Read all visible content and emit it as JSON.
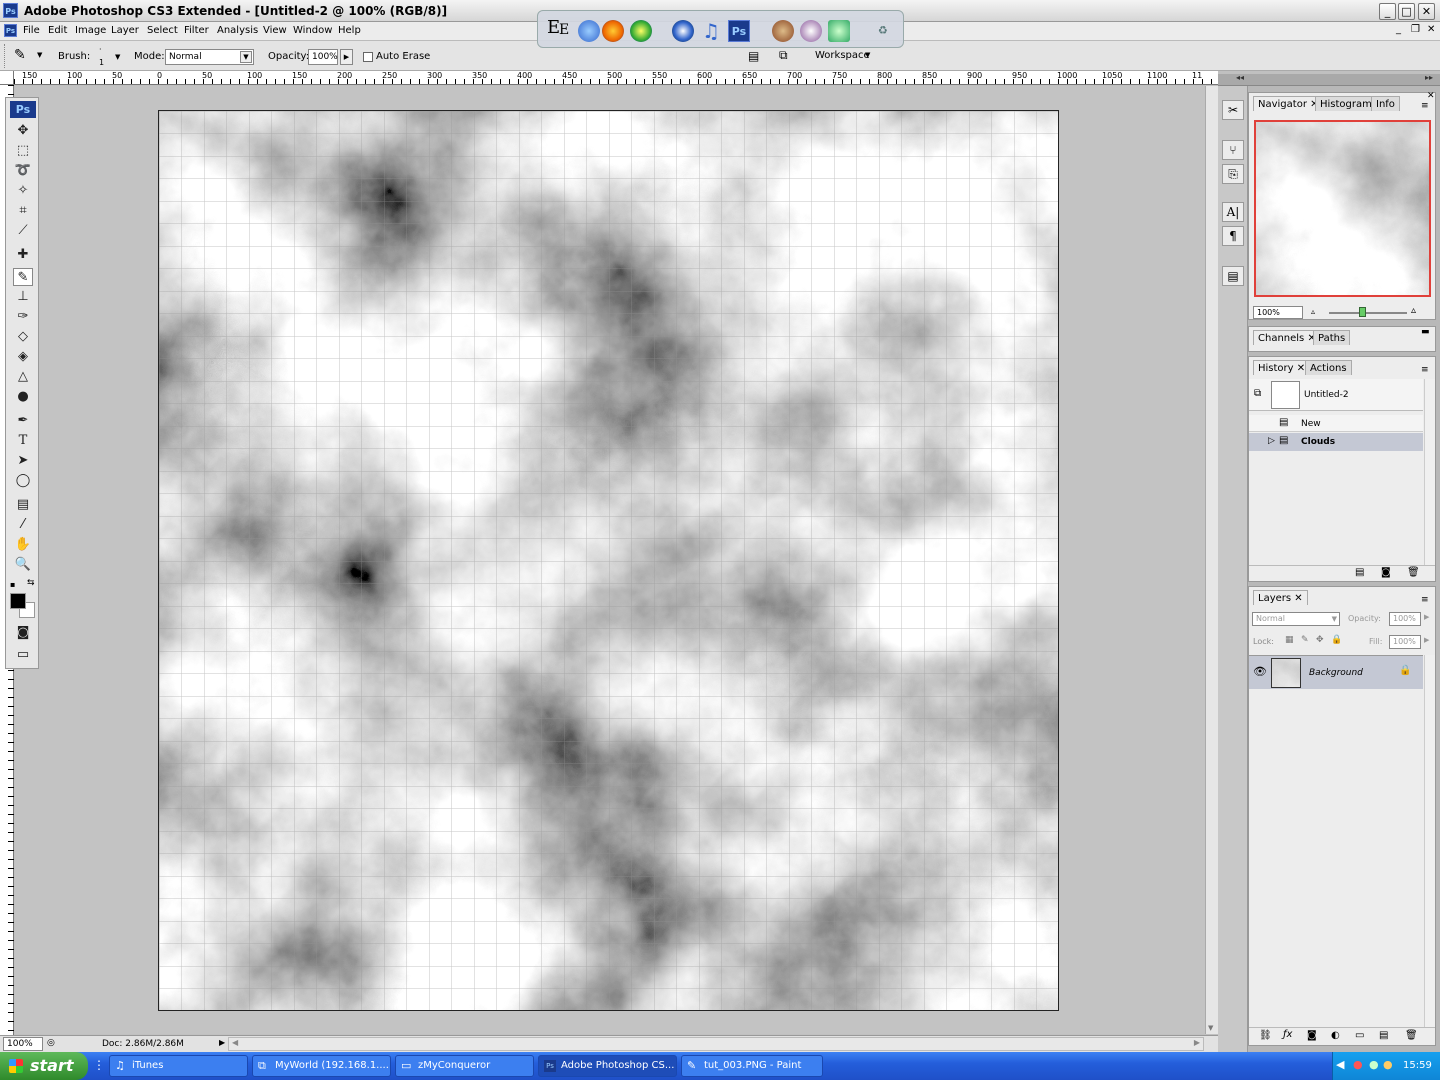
{
  "window": {
    "title": "Adobe Photoshop CS3 Extended - [Untitled-2 @ 100% (RGB/8)]",
    "app_badge": "Ps"
  },
  "menu": [
    "File",
    "Edit",
    "Image",
    "Layer",
    "Select",
    "Filter",
    "Analysis",
    "View",
    "Window",
    "Help"
  ],
  "options": {
    "brush_label": "Brush:",
    "brush_size": "1",
    "mode_label": "Mode:",
    "mode_value": "Normal",
    "opacity_label": "Opacity:",
    "opacity_value": "100%",
    "auto_erase_label": "Auto Erase",
    "workspace_label": "Workspace"
  },
  "ruler_labels": [
    "150",
    "100",
    "50",
    "0",
    "50",
    "100",
    "150",
    "200",
    "250",
    "300",
    "350",
    "400",
    "450",
    "500",
    "550",
    "600",
    "650",
    "700",
    "750",
    "800",
    "850",
    "900",
    "950",
    "1000",
    "1050",
    "1100",
    "11"
  ],
  "toolbox": {
    "logo": "Ps"
  },
  "status": {
    "zoom": "100%",
    "doc": "Doc: 2.86M/2.86M"
  },
  "navigator": {
    "tabs": [
      "Navigator",
      "Histogram",
      "Info"
    ],
    "zoom": "100%"
  },
  "channels": {
    "tabs": [
      "Channels",
      "Paths"
    ]
  },
  "history": {
    "tabs": [
      "History",
      "Actions"
    ],
    "snapshot": "Untitled-2",
    "items": [
      "New",
      "Clouds"
    ]
  },
  "layers": {
    "tab": "Layers",
    "blend": "Normal",
    "opacity_label": "Opacity:",
    "opacity": "100%",
    "lock_label": "Lock:",
    "fill_label": "Fill:",
    "fill": "100%",
    "layer_name": "Background"
  },
  "taskbar": {
    "start": "start",
    "tasks": [
      "iTunes",
      "MyWorld (192.168.1....",
      "zMyConqueror",
      "Adobe Photoshop CS...",
      "tut_003.PNG - Paint"
    ],
    "clock": "15:59"
  },
  "colors": {
    "accent": "#245edb",
    "selection": "#c4c8d4",
    "nav_frame": "#e0403a"
  }
}
